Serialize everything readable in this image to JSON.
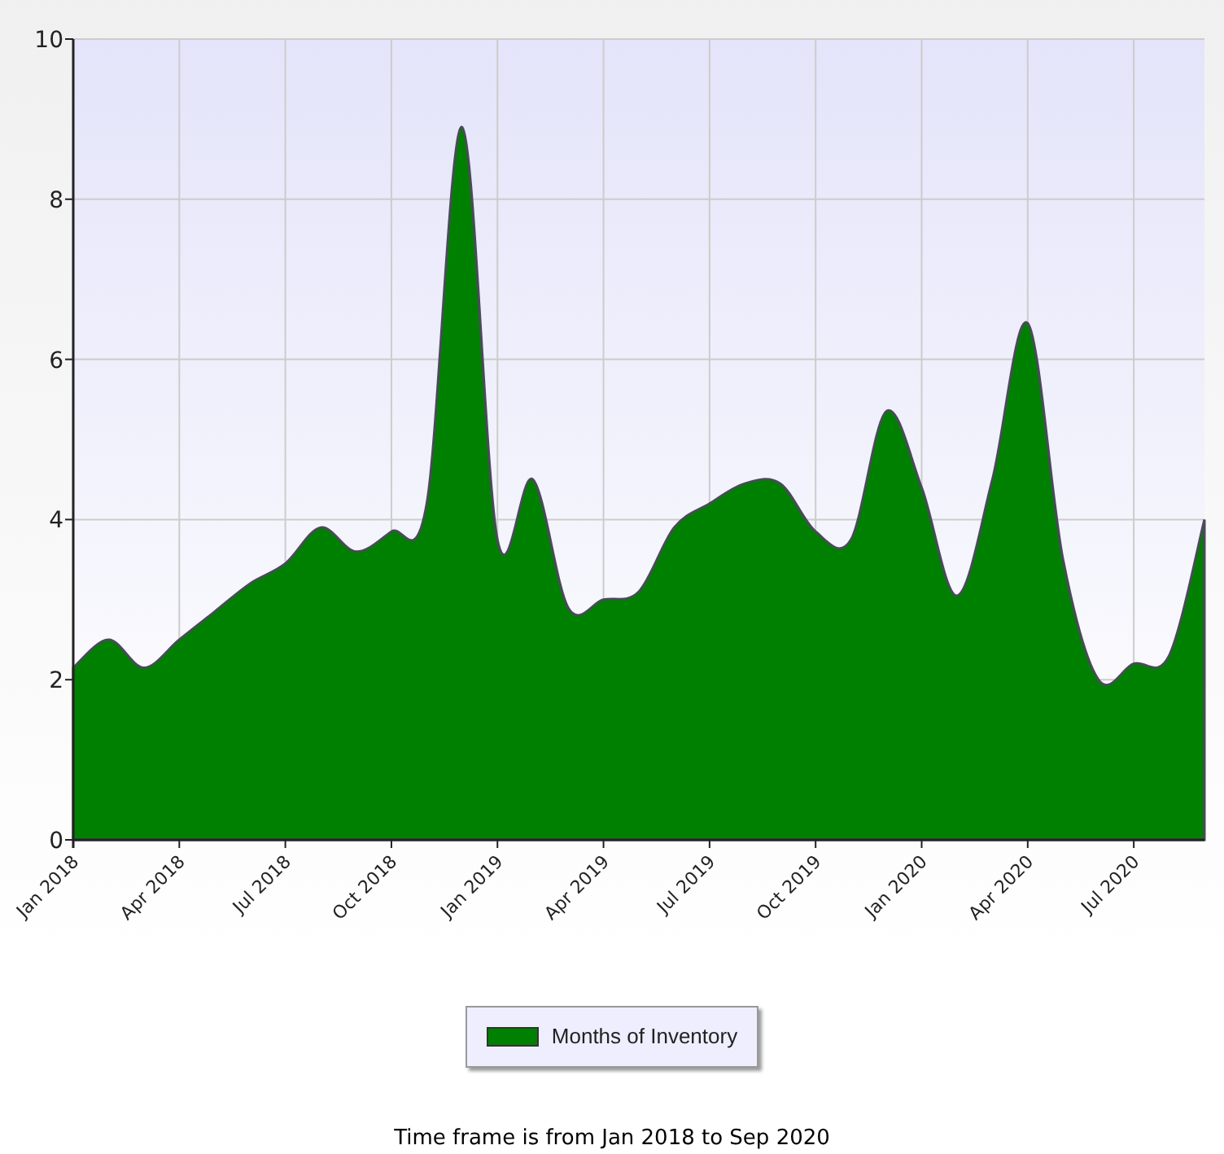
{
  "chart": {
    "chart_data": {
      "type": "area",
      "categories": [
        "Jan 2018",
        null,
        null,
        "Apr 2018",
        null,
        null,
        "Jul 2018",
        null,
        null,
        "Oct 2018",
        null,
        null,
        "Jan 2019",
        null,
        null,
        "Apr 2019",
        null,
        null,
        "Jul 2019",
        null,
        null,
        "Oct 2019",
        null,
        null,
        "Jan 2020",
        null,
        null,
        "Apr 2020",
        null,
        null,
        "Jul 2020",
        null,
        null
      ],
      "series": [
        {
          "name": "Months of Inventory",
          "color": "#008000",
          "values": [
            2.15,
            2.5,
            2.15,
            2.5,
            2.85,
            3.2,
            3.45,
            3.9,
            3.6,
            3.85,
            4.2,
            8.9,
            3.75,
            4.5,
            2.9,
            3.0,
            3.1,
            3.9,
            4.2,
            4.45,
            4.45,
            3.85,
            3.75,
            5.35,
            4.4,
            3.05,
            4.5,
            6.45,
            3.5,
            2.0,
            2.2,
            2.3,
            4.0
          ]
        }
      ],
      "ylim": [
        0,
        10
      ],
      "yticks": [
        0,
        2,
        4,
        6,
        8,
        10
      ],
      "grid": true
    }
  },
  "caption": "Time frame is from Jan 2018 to Sep 2020"
}
